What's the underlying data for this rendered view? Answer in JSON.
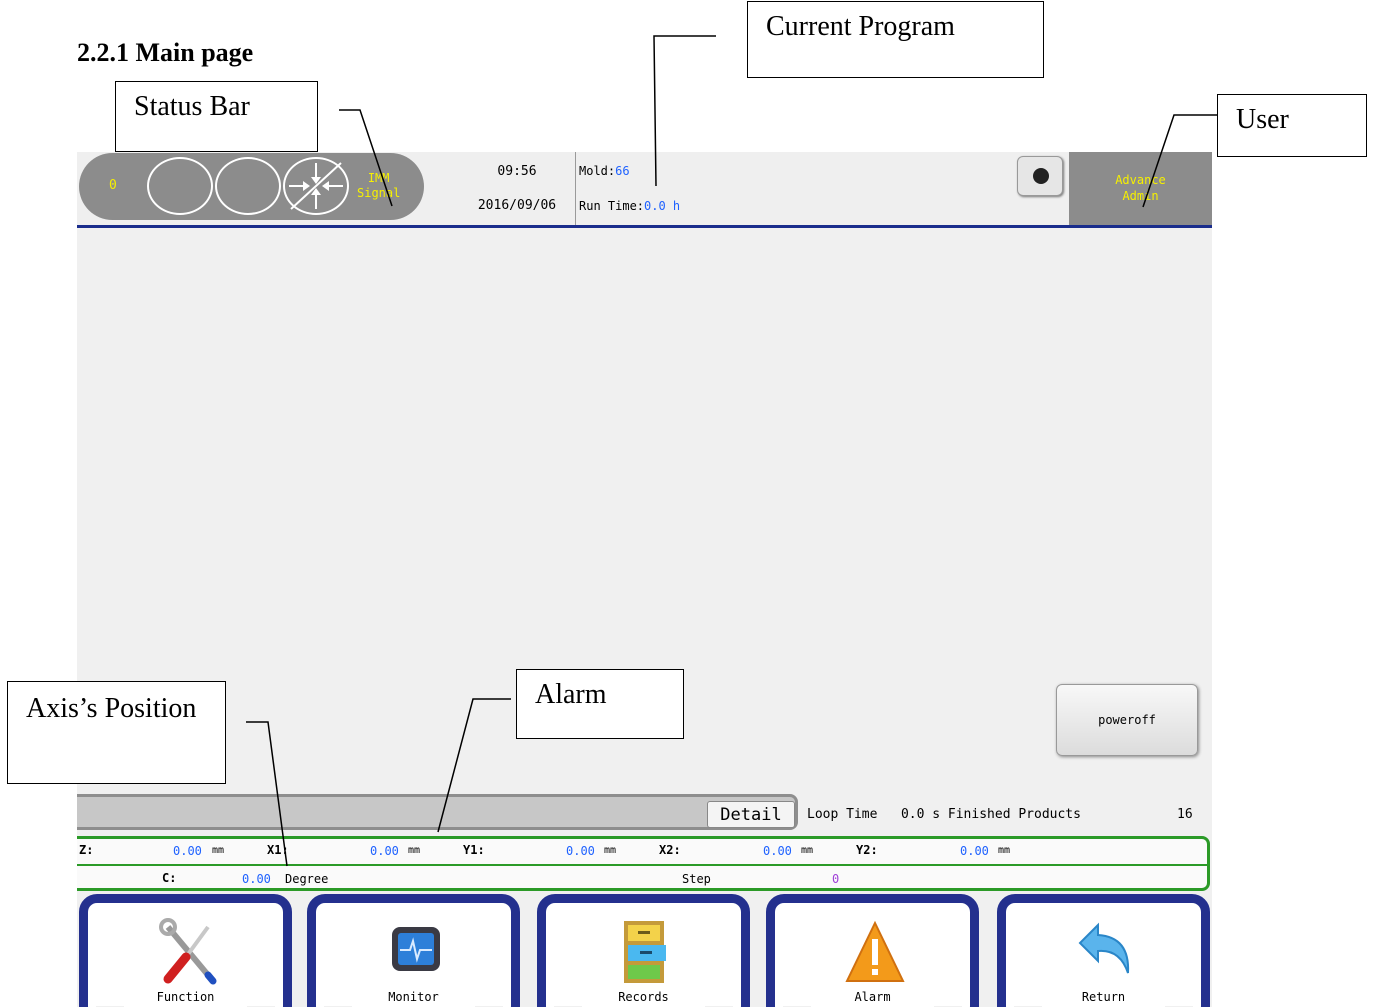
{
  "heading": "2.2.1 Main page",
  "callouts": {
    "status_bar": "Status Bar",
    "current_program": "Current Program",
    "user": "User",
    "alarm": "Alarm",
    "axis_position": "Axis’s Position"
  },
  "status_bar": {
    "counter": "0",
    "imm_signal_line1": "IMM",
    "imm_signal_line2": "Signal",
    "time": "09:56",
    "date": "2016/09/06",
    "mold_label": "Mold:",
    "mold_value": "66",
    "run_time_label": "Run Time:",
    "run_time_value": "0.0 h",
    "user_level": "Advance",
    "user_name": "Admin"
  },
  "poweroff_label": "poweroff",
  "alarm_bar": {
    "detail_label": "Detail",
    "loop_time_label": "Loop Time",
    "loop_time_value": "0.0 s",
    "finished_products_label": "Finished Products",
    "finished_products_value": "16"
  },
  "axes": {
    "z_label": "Z:",
    "z_value": "0.00",
    "z_unit": "mm",
    "x1_label": "X1:",
    "x1_value": "0.00",
    "x1_unit": "mm",
    "y1_label": "Y1:",
    "y1_value": "0.00",
    "y1_unit": "mm",
    "x2_label": "X2:",
    "x2_value": "0.00",
    "x2_unit": "mm",
    "y2_label": "Y2:",
    "y2_value": "0.00",
    "y2_unit": "mm",
    "c_label": "C:",
    "c_value": "0.00",
    "c_unit": "Degree",
    "step_label": "Step",
    "step_value": "0"
  },
  "nav": {
    "function": "Function",
    "monitor": "Monitor",
    "records": "Records",
    "alarm": "Alarm",
    "return": "Return"
  },
  "colors": {
    "status_pill": "#8c8c8c",
    "signal_text": "#f6f000",
    "value_blue": "#1f62ff",
    "axis_border": "#2b9a27",
    "nav_border": "#24308e",
    "status_underline": "#1a2d8c"
  },
  "icons": [
    "wrench-screwdriver-icon",
    "monitor-icon",
    "file-cabinet-icon",
    "warning-icon",
    "return-arrow-icon",
    "camera-icon"
  ]
}
